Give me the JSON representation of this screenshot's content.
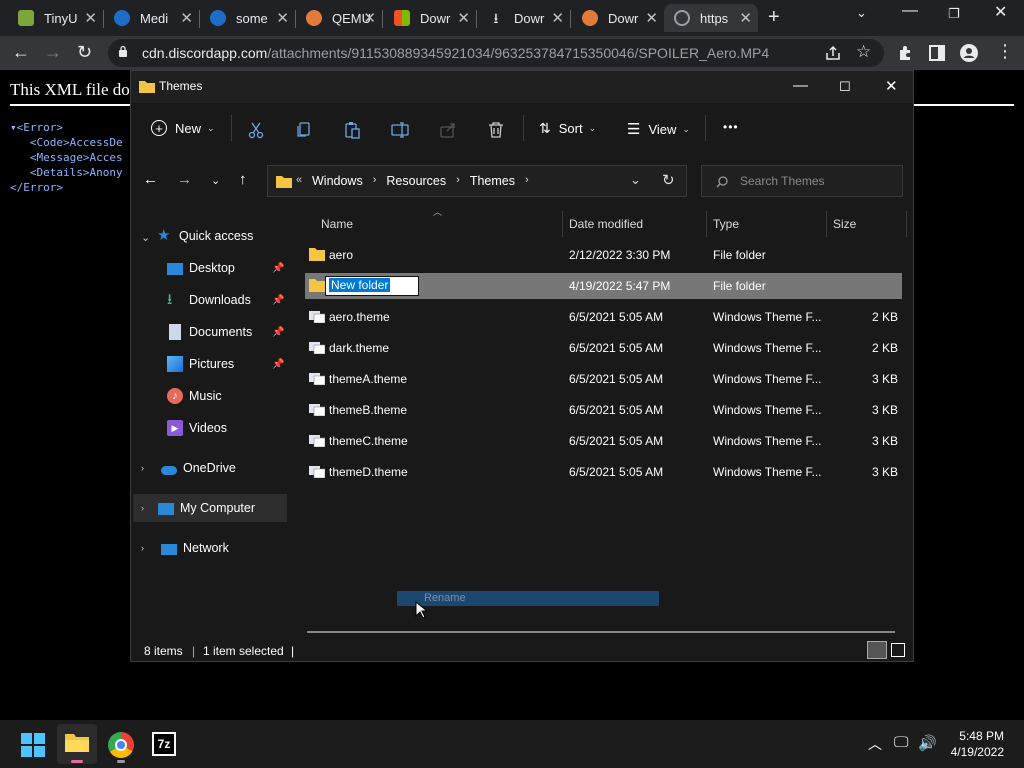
{
  "browser": {
    "tabs": [
      {
        "label": "TinyU",
        "icon": "tiny-icon",
        "color": "#7aa63b"
      },
      {
        "label": "Medi",
        "icon": "media-icon",
        "color": "#1e6ec8"
      },
      {
        "label": "some",
        "icon": "some-icon",
        "color": "#1e6ec8"
      },
      {
        "label": "QEMU",
        "icon": "qemu-icon",
        "color": "#e07b39"
      },
      {
        "label": "Dowr",
        "icon": "microsoft-icon",
        "color": "#f25022"
      },
      {
        "label": "Dowr",
        "icon": "download-icon",
        "color": "#e8eaed"
      },
      {
        "label": "Dowr",
        "icon": "qemu-icon",
        "color": "#e07b39"
      },
      {
        "label": "https",
        "icon": "globe-icon",
        "color": "#9aa0a6"
      }
    ],
    "url_host": "cdn.discordapp.com",
    "url_path": "/attachments/911530889345921034/963253784715350046/SPOILER_Aero.MP4"
  },
  "xml": {
    "heading": "This XML file doe",
    "lines": [
      {
        "indent": "",
        "text": "▾<Error>"
      },
      {
        "indent": "  ",
        "text": "<Code>AccessDe"
      },
      {
        "indent": "  ",
        "text": "<Message>Acces"
      },
      {
        "indent": "  ",
        "text": "<Details>Anony"
      },
      {
        "indent": "",
        "text": "</Error>"
      }
    ]
  },
  "explorer": {
    "title": "Themes",
    "commands": {
      "new": "New",
      "sort": "Sort",
      "view": "View",
      "more": "•••"
    },
    "breadcrumb": [
      "Windows",
      "Resources",
      "Themes"
    ],
    "search_placeholder": "Search Themes",
    "nav": {
      "quick_access": "Quick access",
      "items": [
        "Desktop",
        "Downloads",
        "Documents",
        "Pictures",
        "Music",
        "Videos"
      ],
      "onedrive": "OneDrive",
      "my_computer": "My Computer",
      "network": "Network"
    },
    "columns": {
      "name": "Name",
      "date": "Date modified",
      "type": "Type",
      "size": "Size"
    },
    "files": [
      {
        "name": "aero",
        "date": "2/12/2022 3:30 PM",
        "type": "File folder",
        "size": "",
        "kind": "folder"
      },
      {
        "name": "New folder",
        "date": "4/19/2022 5:47 PM",
        "type": "File folder",
        "size": "",
        "kind": "folder"
      },
      {
        "name": "aero.theme",
        "date": "6/5/2021 5:05 AM",
        "type": "Windows Theme F...",
        "size": "2 KB",
        "kind": "theme"
      },
      {
        "name": "dark.theme",
        "date": "6/5/2021 5:05 AM",
        "type": "Windows Theme F...",
        "size": "2 KB",
        "kind": "theme"
      },
      {
        "name": "themeA.theme",
        "date": "6/5/2021 5:05 AM",
        "type": "Windows Theme F...",
        "size": "3 KB",
        "kind": "theme"
      },
      {
        "name": "themeB.theme",
        "date": "6/5/2021 5:05 AM",
        "type": "Windows Theme F...",
        "size": "3 KB",
        "kind": "theme"
      },
      {
        "name": "themeC.theme",
        "date": "6/5/2021 5:05 AM",
        "type": "Windows Theme F...",
        "size": "3 KB",
        "kind": "theme"
      },
      {
        "name": "themeD.theme",
        "date": "6/5/2021 5:05 AM",
        "type": "Windows Theme F...",
        "size": "3 KB",
        "kind": "theme"
      }
    ],
    "rename_value": "New folder",
    "tooltip": "Rename",
    "status": {
      "count": "8 items",
      "selected": "1 item selected"
    }
  },
  "taskbar": {
    "time": "5:48 PM",
    "date": "4/19/2022",
    "sevenzip_label": "7z"
  },
  "colors": {
    "folder": "#f4c542",
    "selection": "#0078d4",
    "accent_blue": "#2b88d8"
  }
}
